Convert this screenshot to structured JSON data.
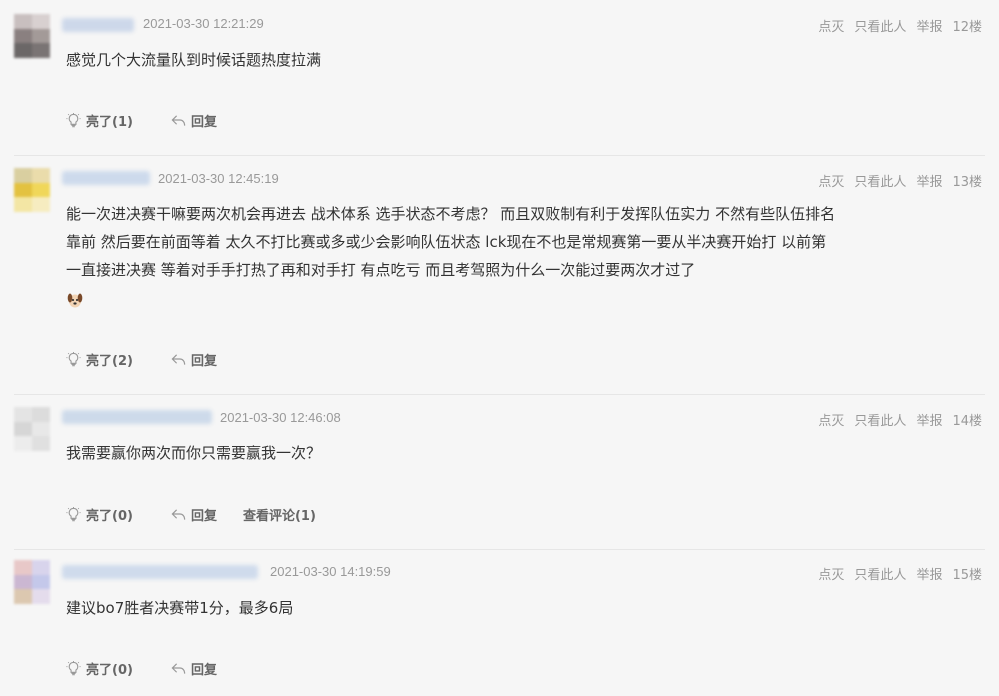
{
  "actions": {
    "dislike": "点灭",
    "only_this": "只看此人",
    "report": "举报"
  },
  "footer_labels": {
    "reply": "回复"
  },
  "comments": [
    {
      "time": "2021-03-30 12:21:29",
      "floor": "12楼",
      "text": "感觉几个大流量队到时候话题热度拉满",
      "likes": "亮了(1)"
    },
    {
      "time": "2021-03-30 12:45:19",
      "floor": "13楼",
      "text": "能一次进决赛干嘛要两次机会再进去 战术体系 选手状态不考虑？ 而且双败制有利于发挥队伍实力 不然有些队伍排名靠前 然后要在前面等着 太久不打比赛或多或少会影响队伍状态 lck现在不也是常规赛第一要从半决赛开始打 以前第一直接进决赛 等着对手手打热了再和对手打 有点吃亏 而且考驾照为什么一次能过要两次才过了",
      "emoji": "dog-face-icon",
      "likes": "亮了(2)"
    },
    {
      "time": "2021-03-30 12:46:08",
      "floor": "14楼",
      "text": "我需要赢你两次而你只需要赢我一次？",
      "likes": "亮了(0)",
      "view_comments": "查看评论(1)"
    },
    {
      "time": "2021-03-30 14:19:59",
      "floor": "15楼",
      "text": "建议bo7胜者决赛带1分，最多6局",
      "likes": "亮了(0)"
    }
  ]
}
